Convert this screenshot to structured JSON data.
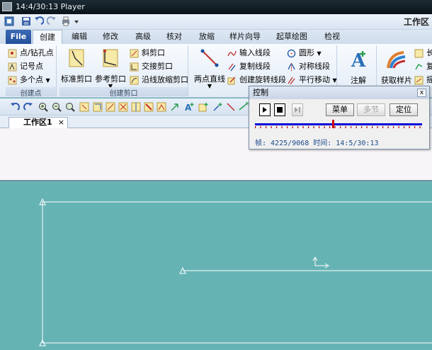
{
  "window": {
    "title": "14:4/30:13 Player",
    "doc_title": "工作区"
  },
  "tabs": [
    {
      "label": "File"
    },
    {
      "label": "创建"
    },
    {
      "label": "编辑"
    },
    {
      "label": "修改"
    },
    {
      "label": "高级"
    },
    {
      "label": "核对"
    },
    {
      "label": "放缩"
    },
    {
      "label": "样片向导"
    },
    {
      "label": "起草绘图"
    },
    {
      "label": "检视"
    }
  ],
  "ribbon": {
    "group_points": {
      "label": "创建点",
      "items": [
        "点/钻孔点",
        "记号点",
        "多个点"
      ]
    },
    "group_notch": {
      "label": "创建剪口",
      "big": [
        "标准剪口",
        "参考剪口"
      ],
      "items": [
        "斜剪口",
        "交接剪口",
        "沿线放缩剪口"
      ]
    },
    "group_lines": {
      "big": "两点直线",
      "items": [
        "输入线段",
        "复制线段",
        "创建旋转线段",
        "圆形",
        "对称线段",
        "平行移动"
      ]
    },
    "group_note": {
      "big": "注解"
    },
    "group_sample": {
      "big": "获取样片",
      "items": [
        "长",
        "复",
        "摇"
      ]
    }
  },
  "document": {
    "tab_label": "工作区1",
    "close": "×"
  },
  "control": {
    "title": "控制",
    "close": "x",
    "menu_button": "菜单",
    "multi_button": "多节",
    "locate_button": "定位",
    "progress": 0.465,
    "status": "帧: 4225/9068 时间: 14:5/30:13"
  }
}
